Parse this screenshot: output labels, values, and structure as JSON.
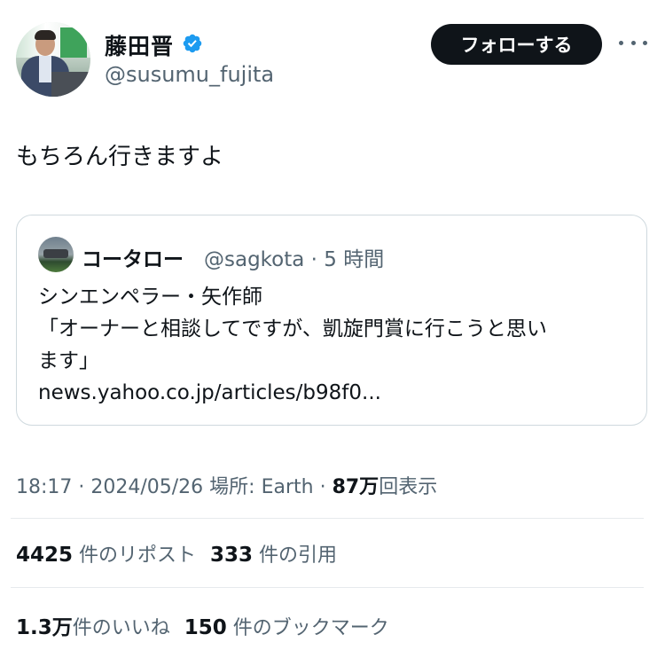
{
  "author": {
    "display_name": "藤田晋",
    "handle": "@susumu_fujita",
    "verified_icon": "verified-badge-icon",
    "verified_color": "#1d9bf0"
  },
  "follow_button_label": "フォローする",
  "more_icon": "more-horizontal-icon",
  "tweet_text": "もちろん行きますよ",
  "quoted_tweet": {
    "display_name": "コータロー",
    "handle_time": "@sagkota · 5 時間",
    "lines": [
      "シンエンペラー・矢作師",
      "「オーナーと相談してですが、凱旋門賞に行こうと思い",
      "ます」",
      "news.yahoo.co.jp/articles/b98f0..."
    ]
  },
  "meta": {
    "time_date_location": "18:17 · 2024/05/26 場所: Earth · ",
    "views_count": "87万",
    "views_label": "回表示"
  },
  "stats": {
    "reposts_count": "4425",
    "reposts_label": "件のリポスト",
    "quotes_count": "333",
    "quotes_label": "件の引用",
    "likes_count": "1.3万",
    "likes_label": "件のいいね",
    "bookmarks_count": "150",
    "bookmarks_label": "件のブックマーク"
  },
  "colors": {
    "text": "#0f1419",
    "secondary": "#536471",
    "border": "#cfd9de"
  }
}
